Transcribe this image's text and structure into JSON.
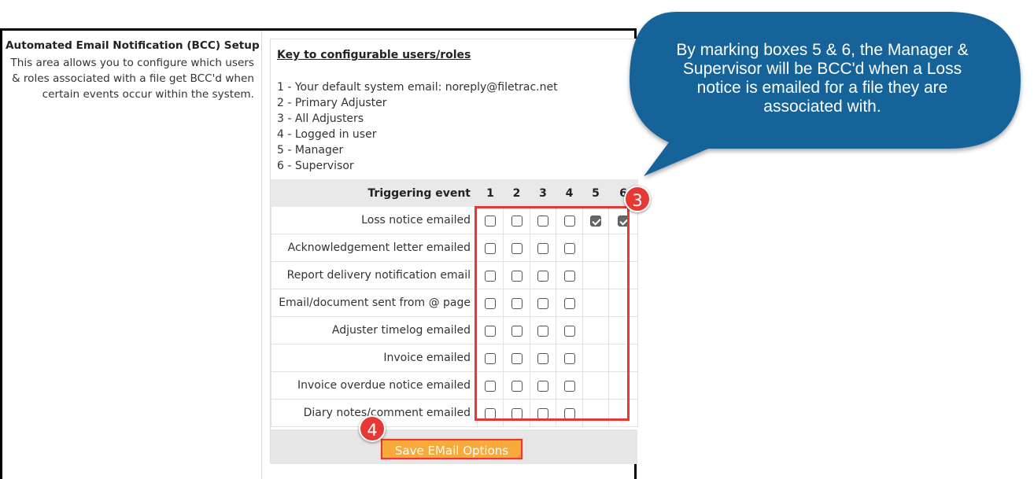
{
  "setup": {
    "title": "Automated Email Notification (BCC) Setup",
    "description": "This area allows you to configure which users & roles associated with a file get BCC'd when certain events occur within the system."
  },
  "key": {
    "title": "Key to configurable users/roles",
    "items": [
      "1 - Your default system email: noreply@filetrac.net",
      "2 - Primary Adjuster",
      "3 - All Adjusters",
      "4 - Logged in user",
      "5 - Manager",
      "6 - Supervisor"
    ]
  },
  "grid": {
    "header": {
      "event_label": "Triggering event",
      "columns": [
        "1",
        "2",
        "3",
        "4",
        "5",
        "6"
      ]
    },
    "rows": [
      {
        "event": "Loss notice emailed",
        "checks": [
          false,
          false,
          false,
          false,
          true,
          true
        ]
      },
      {
        "event": "Acknowledgement letter emailed",
        "checks": [
          false,
          false,
          false,
          false
        ]
      },
      {
        "event": "Report delivery notification email",
        "checks": [
          false,
          false,
          false,
          false
        ]
      },
      {
        "event": "Email/document sent from @ page",
        "checks": [
          false,
          false,
          false,
          false
        ]
      },
      {
        "event": "Adjuster timelog emailed",
        "checks": [
          false,
          false,
          false,
          false
        ]
      },
      {
        "event": "Invoice emailed",
        "checks": [
          false,
          false,
          false,
          false
        ]
      },
      {
        "event": "Invoice overdue notice emailed",
        "checks": [
          false,
          false,
          false,
          false
        ]
      },
      {
        "event": "Diary notes/comment emailed",
        "checks": [
          false,
          false,
          false,
          false
        ]
      }
    ]
  },
  "save_button": "Save EMail Options",
  "callout": {
    "text": "By marking boxes 5 & 6, the Manager & Supervisor will be BCC'd when a Loss notice is emailed for a file they are associated with."
  },
  "markers": {
    "step3": "3",
    "step4": "4"
  },
  "colors": {
    "callout_fill": "#19639a",
    "highlight": "#e53935",
    "save_button": "#f7a93b",
    "table_header": "#e9e9e9",
    "checked_box": "#666666"
  }
}
